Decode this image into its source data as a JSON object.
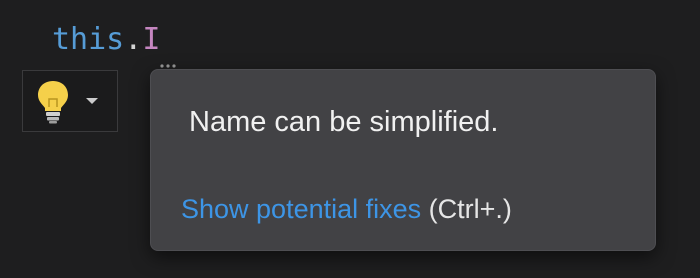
{
  "editor": {
    "code": {
      "keyword": "this",
      "dot": ".",
      "member": "I"
    }
  },
  "lightbulb": {
    "icon": "lightbulb-icon",
    "dropdown_icon": "chevron-down-icon"
  },
  "tooltip": {
    "message": "Name can be simplified.",
    "action_link": "Show potential fixes",
    "shortcut": " (Ctrl+.)"
  },
  "colors": {
    "background": "#1e1e1f",
    "keyword": "#569cd6",
    "member": "#c586c0",
    "tooltip_background": "#424245",
    "link": "#3d95e6",
    "lightbulb": "#f5d04a"
  }
}
